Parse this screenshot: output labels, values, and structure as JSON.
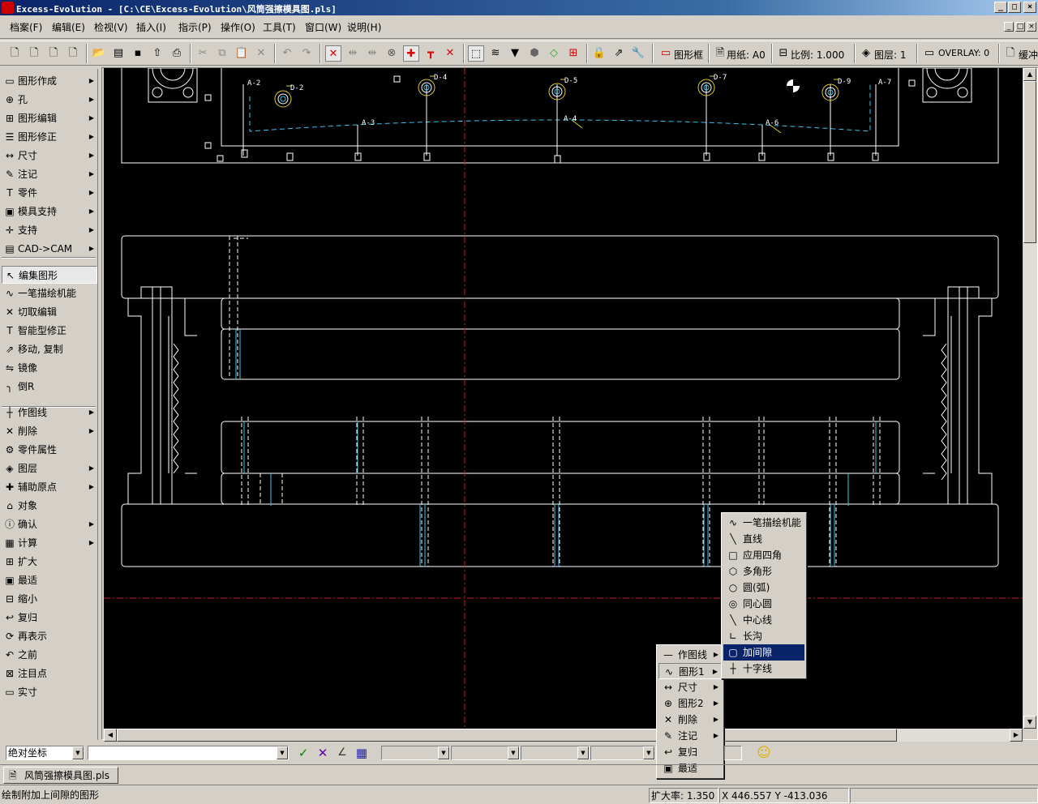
{
  "window": {
    "title": "Excess-Evolution - [C:\\CE\\Excess-Evolution\\风筒强擦模具图.pls]",
    "min_label": "_",
    "max_label": "□",
    "close_label": "×"
  },
  "menu": [
    "档案(F)",
    "编辑(E)",
    "检视(V)",
    "插入(I)",
    "指示(P)",
    "操作(O)",
    "工具(T)",
    "窗口(W)",
    "说明(H)"
  ],
  "toolbar": {
    "frame_label": "图形框",
    "paper_label": "用纸: A0",
    "scale_label": "比例: 1.000",
    "layer_label": "图层: 1",
    "overlay_label": "OVERLAY: 0",
    "buffer_label": "缓冲"
  },
  "left_panel": {
    "group1": [
      {
        "label": "图形作成",
        "icon": "rect-icon",
        "glyph": "▭",
        "arrow": true
      },
      {
        "label": "孔",
        "icon": "hole-icon",
        "glyph": "⊕",
        "arrow": true
      },
      {
        "label": "图形编辑",
        "icon": "shape-edit-icon",
        "glyph": "⊞",
        "arrow": true
      },
      {
        "label": "图形修正",
        "icon": "shape-fix-icon",
        "glyph": "☰",
        "arrow": true
      },
      {
        "label": "尺寸",
        "icon": "dimension-icon",
        "glyph": "↔",
        "arrow": true
      },
      {
        "label": "注记",
        "icon": "annotation-icon",
        "glyph": "✎",
        "arrow": true
      },
      {
        "label": "零件",
        "icon": "part-icon",
        "glyph": "T",
        "arrow": true
      },
      {
        "label": "模具支持",
        "icon": "mold-icon",
        "glyph": "▣",
        "arrow": true
      },
      {
        "label": "支持",
        "icon": "support-icon",
        "glyph": "✛",
        "arrow": true
      },
      {
        "label": "CAD->CAM",
        "icon": "cadcam-icon",
        "glyph": "▤",
        "arrow": true
      }
    ],
    "group2": [
      {
        "label": "编集图形",
        "icon": "pointer-icon",
        "glyph": "↖",
        "arrow": false,
        "selected": true
      },
      {
        "label": "一笔描绘机能",
        "icon": "polyline-icon",
        "glyph": "∿",
        "arrow": false
      },
      {
        "label": "切取编辑",
        "icon": "cut-icon",
        "glyph": "✕",
        "arrow": false
      },
      {
        "label": "智能型修正",
        "icon": "smart-fix-icon",
        "glyph": "T",
        "arrow": false
      },
      {
        "label": "移动, 复制",
        "icon": "move-copy-icon",
        "glyph": "⇗",
        "arrow": false
      },
      {
        "label": "镜像",
        "icon": "mirror-icon",
        "glyph": "⇋",
        "arrow": false
      },
      {
        "label": "倒R",
        "icon": "fillet-icon",
        "glyph": "╮",
        "arrow": false
      }
    ],
    "group3": [
      {
        "label": "作图线",
        "icon": "construction-line-icon",
        "glyph": "┼",
        "arrow": true
      },
      {
        "label": "削除",
        "icon": "delete-icon",
        "glyph": "✕",
        "arrow": true
      },
      {
        "label": "零件属性",
        "icon": "part-attr-icon",
        "glyph": "⚙",
        "arrow": false
      },
      {
        "label": "图层",
        "icon": "layer-icon",
        "glyph": "◈",
        "arrow": true
      },
      {
        "label": "辅助原点",
        "icon": "origin-icon",
        "glyph": "✚",
        "arrow": true
      },
      {
        "label": "对象",
        "icon": "object-icon",
        "glyph": "⌂",
        "arrow": false
      },
      {
        "label": "确认",
        "icon": "info-icon",
        "glyph": "ⓘ",
        "arrow": true
      },
      {
        "label": "计算",
        "icon": "calc-icon",
        "glyph": "▦",
        "arrow": true
      },
      {
        "label": "扩大",
        "icon": "zoom-in-icon",
        "glyph": "⊞",
        "arrow": false
      },
      {
        "label": "最适",
        "icon": "fit-icon",
        "glyph": "▣",
        "arrow": false
      },
      {
        "label": "缩小",
        "icon": "zoom-out-icon",
        "glyph": "⊟",
        "arrow": false
      },
      {
        "label": "复归",
        "icon": "restore-icon",
        "glyph": "↩",
        "arrow": false
      },
      {
        "label": "再表示",
        "icon": "redraw-icon",
        "glyph": "⟳",
        "arrow": false
      },
      {
        "label": "之前",
        "icon": "previous-icon",
        "glyph": "↶",
        "arrow": false
      },
      {
        "label": "注目点",
        "icon": "focus-icon",
        "glyph": "⊠",
        "arrow": false
      },
      {
        "label": "实寸",
        "icon": "actual-size-icon",
        "glyph": "▭",
        "arrow": false
      }
    ]
  },
  "drawing": {
    "labels": [
      "A-2",
      "D-2",
      "D-4",
      "D-5",
      "D-7",
      "D-9",
      "A-7",
      "A-3",
      "A-4",
      "A-6"
    ]
  },
  "context_menu": [
    {
      "label": "作图线",
      "icon": "construction-line-icon",
      "glyph": "—",
      "arrow": true
    },
    {
      "label": "图形1",
      "icon": "shape1-icon",
      "glyph": "∿",
      "arrow": true,
      "active": true
    },
    {
      "label": "尺寸",
      "icon": "dimension-icon",
      "glyph": "↔",
      "arrow": true
    },
    {
      "label": "图形2",
      "icon": "shape2-icon",
      "glyph": "⊕",
      "arrow": true
    },
    {
      "label": "削除",
      "icon": "delete-icon",
      "glyph": "✕",
      "arrow": true
    },
    {
      "label": "注记",
      "icon": "annotation-icon",
      "glyph": "✎",
      "arrow": true
    },
    {
      "label": "复归",
      "icon": "restore-icon",
      "glyph": "↩",
      "arrow": false
    },
    {
      "label": "最适",
      "icon": "fit-icon",
      "glyph": "▣",
      "arrow": false
    }
  ],
  "submenu": [
    {
      "label": "一笔描绘机能",
      "icon": "polyline-icon",
      "glyph": "∿"
    },
    {
      "label": "直线",
      "icon": "line-icon",
      "glyph": "╲"
    },
    {
      "label": "应用四角",
      "icon": "rectangle-icon",
      "glyph": "□"
    },
    {
      "label": "多角形",
      "icon": "polygon-icon",
      "glyph": "⬡"
    },
    {
      "label": "圆(弧)",
      "icon": "circle-icon",
      "glyph": "○"
    },
    {
      "label": "同心圆",
      "icon": "concentric-icon",
      "glyph": "◎"
    },
    {
      "label": "中心线",
      "icon": "centerline-icon",
      "glyph": "╲"
    },
    {
      "label": "长沟",
      "icon": "slot-icon",
      "glyph": "∟"
    },
    {
      "label": "加间隙",
      "icon": "clearance-icon",
      "glyph": "▢",
      "highlighted": true
    },
    {
      "label": "十字线",
      "icon": "crosshair-icon",
      "glyph": "┼"
    }
  ],
  "cmdbar": {
    "coord_mode": "绝对坐标",
    "ok_glyph": "✓",
    "cancel_glyph": "✕"
  },
  "document_tab": "风筒强擦模具图.pls",
  "status": {
    "message": "绘制附加上间隙的图形",
    "zoom": "扩大率: 1.350",
    "coords": "X 446.557 Y -413.036"
  },
  "colors": {
    "canvas_bg": "#000000",
    "outline": "#ffffff",
    "accent_cyan": "#37c6f0",
    "center_red": "#c8201a",
    "leader_yellow": "#e0d020",
    "highlight": "#0a246a"
  }
}
